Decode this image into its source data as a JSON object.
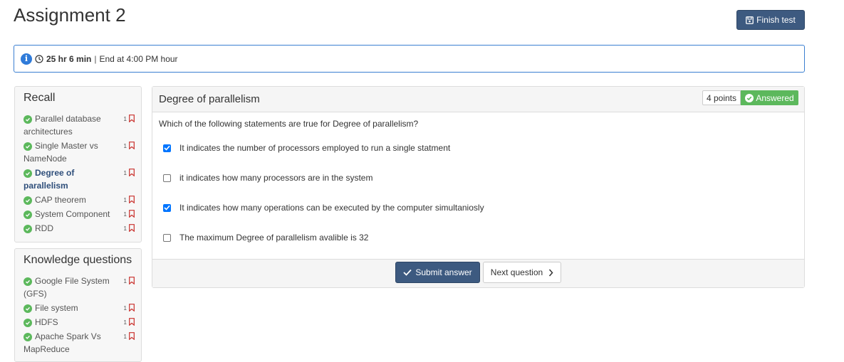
{
  "page": {
    "title": "Assignment 2"
  },
  "header": {
    "finish_label": "Finish test"
  },
  "info_bar": {
    "duration": "25 hr 6 min",
    "separator": "|",
    "end_text": "End at 4:00 PM hour"
  },
  "sidebar": {
    "sections": [
      {
        "title": "Recall",
        "items": [
          {
            "label": "Parallel database architectures",
            "points": "1"
          },
          {
            "label": "Single Master vs NameNode",
            "points": "1"
          },
          {
            "label": "Degree of parallelism",
            "points": "1"
          },
          {
            "label": "CAP theorem",
            "points": "1"
          },
          {
            "label": "System Component",
            "points": "1"
          },
          {
            "label": "RDD",
            "points": "1"
          }
        ]
      },
      {
        "title": "Knowledge questions",
        "items": [
          {
            "label": "Google File System (GFS)",
            "points": "1"
          },
          {
            "label": "File system",
            "points": "1"
          },
          {
            "label": "HDFS",
            "points": "1"
          },
          {
            "label": "Apache Spark Vs MapReduce",
            "points": "1"
          }
        ]
      }
    ]
  },
  "question": {
    "title": "Degree of parallelism",
    "points": "4 points",
    "status": "Answered",
    "text": "Which of the following statements are true for Degree of parallelism?",
    "options": [
      {
        "label": "It indicates the number of processors employed to run a single statment",
        "checked": true
      },
      {
        "label": "it indicates how many processors are in the system",
        "checked": false
      },
      {
        "label": "It indicates how many operations can be executed by the computer simultaniosly",
        "checked": true
      },
      {
        "label": "The maximum Degree of parallelism avalible is 32",
        "checked": false
      }
    ],
    "submit_label": "Submit answer",
    "next_label": "Next question"
  },
  "colors": {
    "primary": "#3d5a80",
    "success": "#5cb85c",
    "info_border": "#3b7fd1",
    "bookmark": "#c9302c",
    "checkbox": "#0075ff"
  }
}
